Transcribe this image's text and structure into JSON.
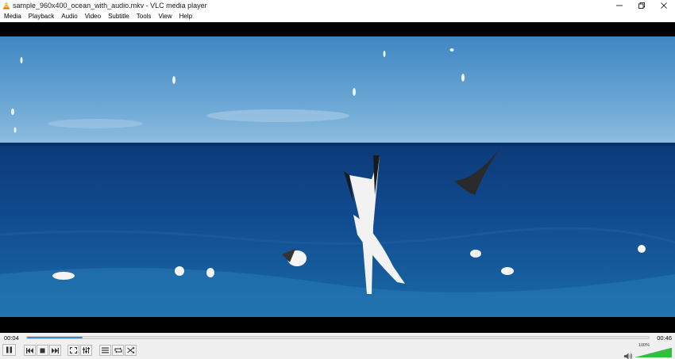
{
  "window": {
    "title": "sample_960x400_ocean_with_audio.mkv - VLC media player"
  },
  "menu": {
    "items": [
      "Media",
      "Playback",
      "Audio",
      "Video",
      "Subtitle",
      "Tools",
      "View",
      "Help"
    ]
  },
  "player": {
    "current_time": "00:04",
    "total_time": "00:46",
    "progress": 0.09,
    "volume_label": "100%",
    "volume": 1.0,
    "accent_color": "#3d88d6",
    "volume_color": "#2fbf3a"
  },
  "icons": {
    "app": "vlc-cone-icon",
    "minimize": "minimize-icon",
    "maximize": "restore-icon",
    "close": "close-icon",
    "play_pause": "pause-icon",
    "prev": "previous-icon",
    "stop": "stop-icon",
    "next": "next-icon",
    "fullscreen": "fullscreen-icon",
    "ext_settings": "extended-settings-icon",
    "playlist": "playlist-icon",
    "loop": "loop-icon",
    "random": "shuffle-icon",
    "volume": "speaker-icon"
  }
}
